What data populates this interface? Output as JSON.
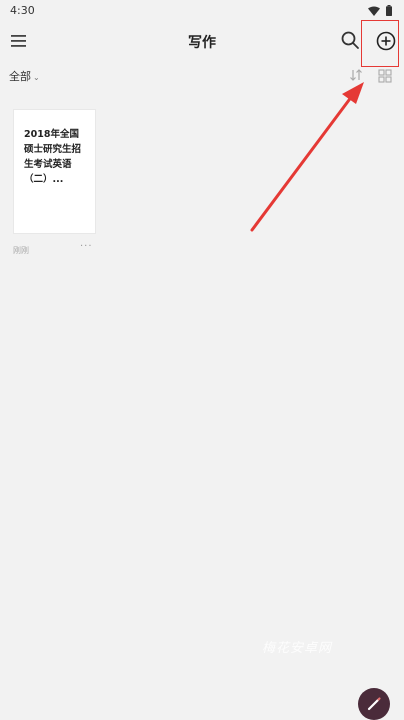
{
  "status_bar": {
    "time": "4:30",
    "wifi_icon": "wifi-icon",
    "battery_icon": "battery-icon"
  },
  "app_bar": {
    "title": "写作",
    "menu_icon": "menu-icon",
    "search_icon": "search-icon",
    "add_icon": "add-circle-icon"
  },
  "filter": {
    "label": "全部",
    "sort_icon": "sort-icon",
    "grid_icon": "grid-view-icon"
  },
  "documents": [
    {
      "title": "2018年全国硕士研究生招生考试英语（二）...",
      "date": "刚刚",
      "more": "···"
    }
  ],
  "annotation": {
    "highlight_color": "#e53935",
    "arrow_color": "#e53935"
  },
  "watermark": "梅花安卓网",
  "fab": {
    "icon": "pen-icon",
    "color": "#4a2b3a"
  }
}
